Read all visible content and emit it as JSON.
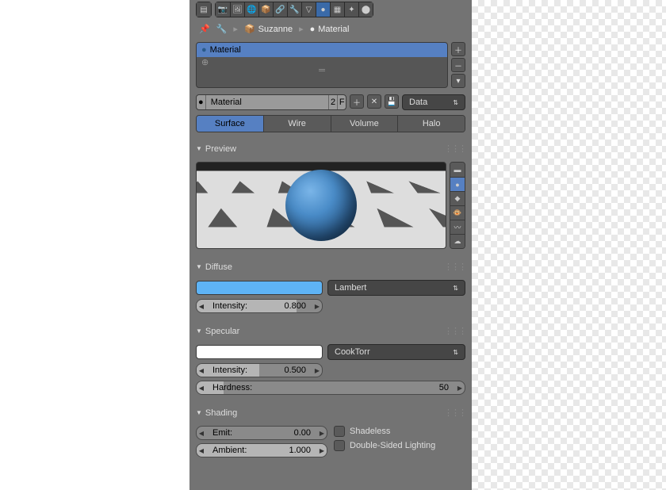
{
  "breadcrumb": {
    "object": "Suzanne",
    "material": "Material"
  },
  "slot": {
    "name": "Material"
  },
  "material_name": {
    "value": "Material",
    "users": "2",
    "fake": "F"
  },
  "data_link": {
    "label": "Data"
  },
  "tabs": {
    "surface": "Surface",
    "wire": "Wire",
    "volume": "Volume",
    "halo": "Halo"
  },
  "sections": {
    "preview": "Preview",
    "diffuse": "Diffuse",
    "specular": "Specular",
    "shading": "Shading"
  },
  "diffuse": {
    "shader": "Lambert",
    "intensity_label": "Intensity:",
    "intensity_value": "0.800"
  },
  "specular": {
    "shader": "CookTorr",
    "intensity_label": "Intensity:",
    "intensity_value": "0.500",
    "hardness_label": "Hardness:",
    "hardness_value": "50"
  },
  "shading": {
    "emit_label": "Emit:",
    "emit_value": "0.00",
    "ambient_label": "Ambient:",
    "ambient_value": "1.000",
    "shadeless": "Shadeless",
    "double_sided": "Double-Sided Lighting"
  }
}
